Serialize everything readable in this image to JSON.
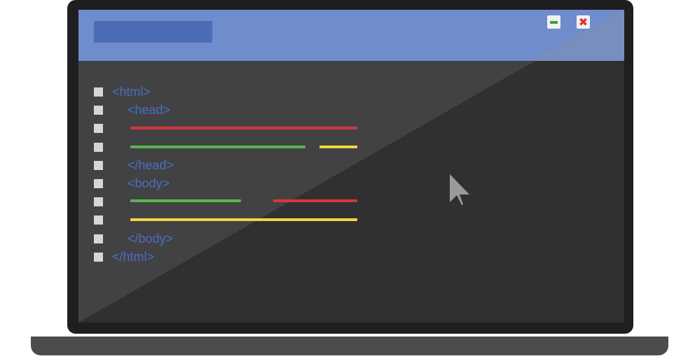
{
  "code": {
    "lines": [
      {
        "tag": "<html>"
      },
      {
        "tag": "<head>"
      },
      {
        "tag": ""
      },
      {
        "tag": ""
      },
      {
        "tag": "</head>"
      },
      {
        "tag": "<body>"
      },
      {
        "tag": ""
      },
      {
        "tag": ""
      },
      {
        "tag": "</body>"
      },
      {
        "tag": "</html>"
      }
    ]
  },
  "window_controls": {
    "minimize_icon": "minimize-icon",
    "close_icon": "close-icon",
    "close_glyph": "✖"
  },
  "colors": {
    "title_bar": "#6f8ccc",
    "title_block": "#4b6cb7",
    "screen": "#424244",
    "tag_text": "#4a6fbe",
    "red_line": "#d9363b",
    "green_line": "#57b64c",
    "yellow_line": "#f2d53c"
  }
}
